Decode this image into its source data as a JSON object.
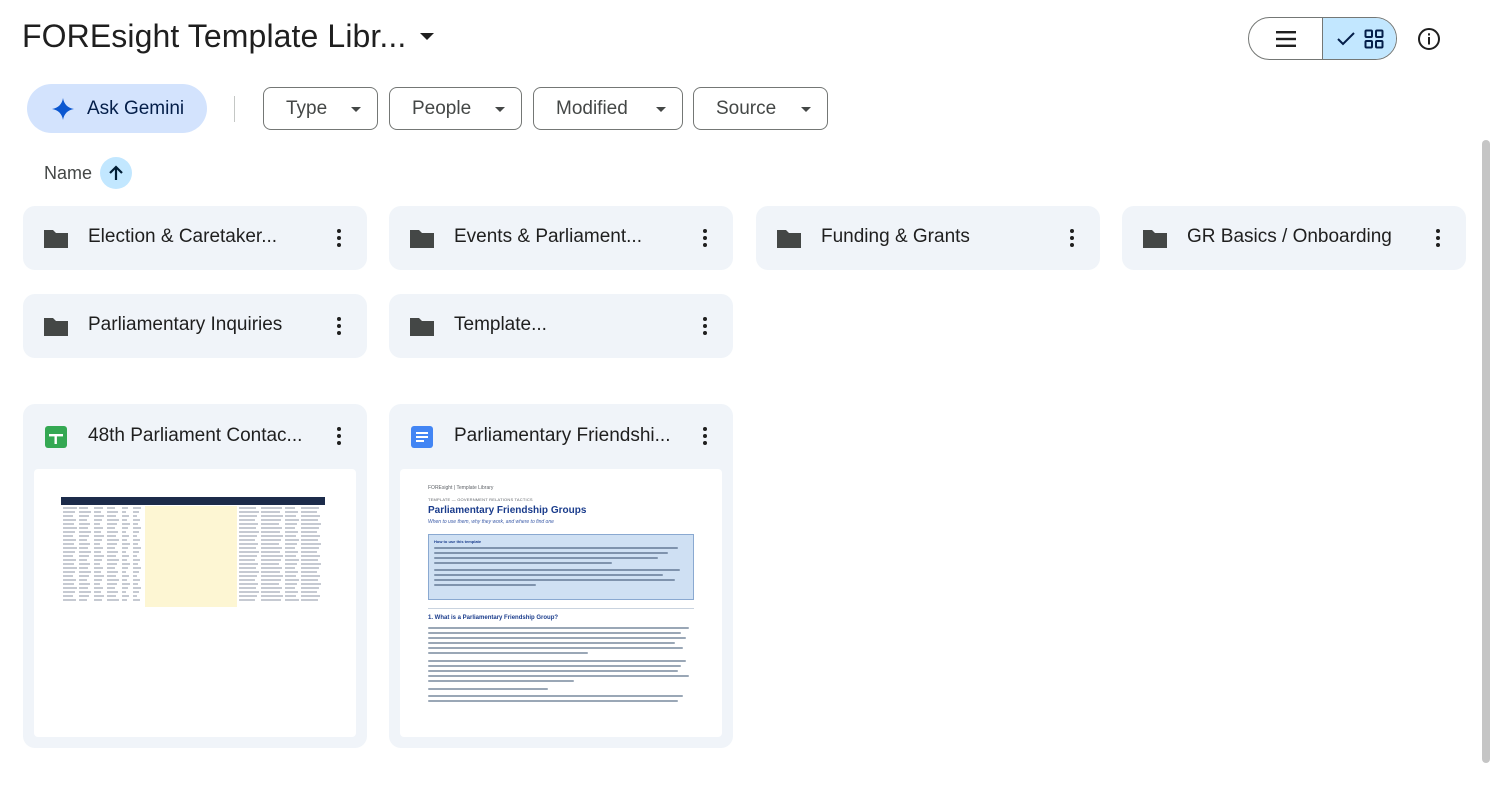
{
  "header": {
    "folder_title": "FOREsight Template Libr...",
    "view": {
      "list_icon": "list-icon",
      "grid_icon": "grid-icon",
      "active": "grid"
    },
    "info_icon": "info-icon"
  },
  "filters": {
    "ask_gemini": "Ask Gemini",
    "chips": [
      "Type",
      "People",
      "Modified",
      "Source"
    ]
  },
  "sort": {
    "label": "Name",
    "direction": "ascending"
  },
  "folders": [
    {
      "name": "Election & Caretaker..."
    },
    {
      "name": "Events & Parliament..."
    },
    {
      "name": "Funding & Grants"
    },
    {
      "name": "GR Basics / Onboarding"
    },
    {
      "name": "Parliamentary Inquiries"
    },
    {
      "name": "Template..."
    }
  ],
  "files": [
    {
      "name": "48th Parliament Contac...",
      "type": "spreadsheet"
    },
    {
      "name": "Parliamentary Friendshi...",
      "type": "document",
      "preview": {
        "brand": "FOREsight  |  Template Library",
        "kicker": "TEMPLATE — GOVERNMENT RELATIONS TACTICS",
        "title": "Parliamentary Friendship Groups",
        "subtitle": "When to use them, why they work, and where to find one",
        "box_title": "How to use this template",
        "section": "1.  What is a Parliamentary Friendship Group?"
      }
    }
  ],
  "colors": {
    "accent_blue": "#c2e7ff",
    "card_bg": "#f0f4f9",
    "gemini_bg": "#d3e3fd",
    "sheets_green": "#34a853",
    "docs_blue": "#4285f4"
  }
}
